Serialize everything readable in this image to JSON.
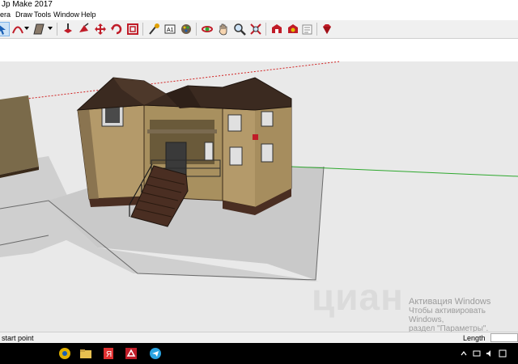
{
  "window": {
    "title": "Jp Make 2017"
  },
  "menu": {
    "items": [
      "era",
      "Draw",
      "Tools",
      "Window",
      "Help"
    ]
  },
  "toolbar": {
    "tools": [
      "arc-tool",
      "paint-bucket-tool",
      "push-pull-tool",
      "move-tool",
      "rotate-tool",
      "offset-tool",
      "tape-measure-tool",
      "text-tool",
      "paint-tool",
      "orbit-tool",
      "pan-tool",
      "zoom-tool",
      "zoom-extents-tool",
      "3d-warehouse",
      "extension-warehouse",
      "layout",
      "ruby-console"
    ]
  },
  "status": {
    "hint": "start point",
    "measure_label": "Length",
    "measure_value": ""
  },
  "watermark": {
    "line1": "Активация Windows",
    "line2": "Чтобы активировать Windows,",
    "line3": "раздел \"Параметры\".",
    "brand": "циан"
  },
  "colors": {
    "wall": "#b49a6a",
    "roof": "#3b2a20",
    "ground": "#c8c8c8",
    "sky": "#e8e8e8",
    "axis_green": "#2ea82e",
    "axis_red": "#d02020"
  }
}
